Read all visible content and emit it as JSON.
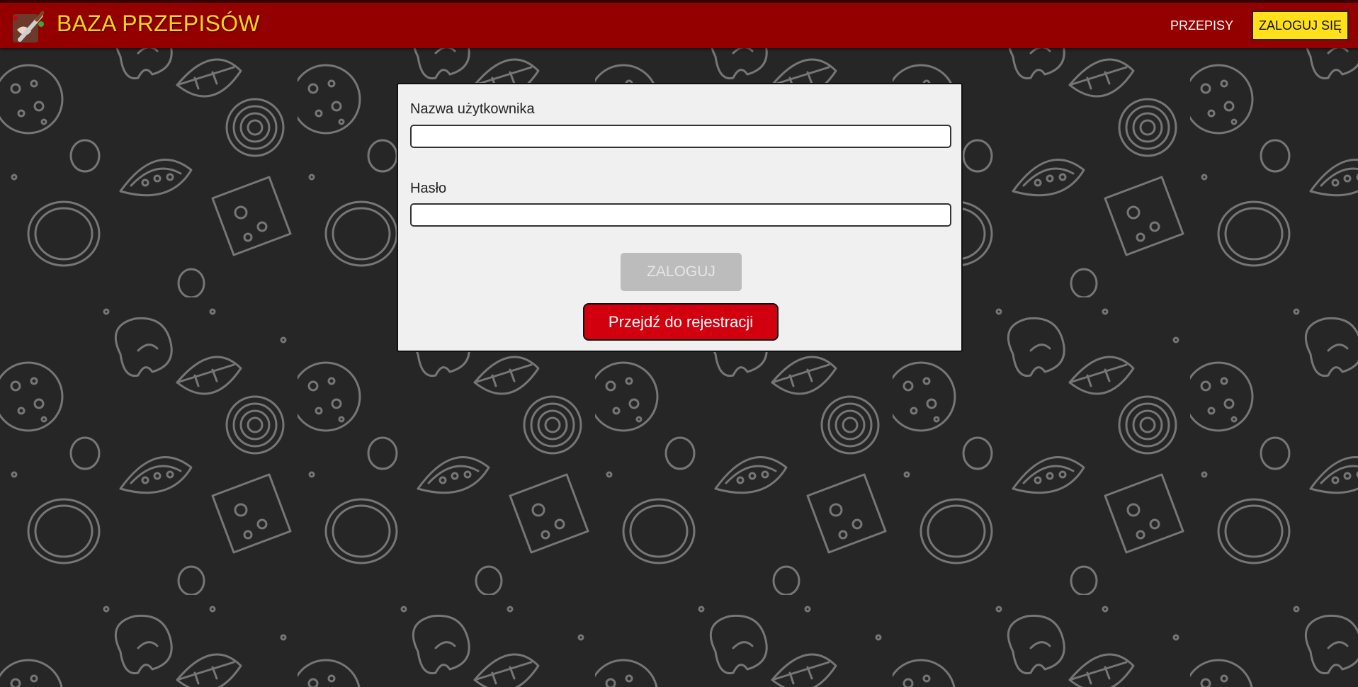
{
  "header": {
    "brand": "BAZA PRZEPISÓW",
    "nav_recipes": "PRZEPISY",
    "nav_login": "ZALOGUJ SIĘ"
  },
  "form": {
    "username_label": "Nazwa użytkownika",
    "username_value": "",
    "password_label": "Hasło",
    "password_value": "",
    "login_button": "ZALOGUJ",
    "register_button": "Przejdź do rejestracji"
  },
  "colors": {
    "header_bg": "#940000",
    "brand_text": "#ffd21a",
    "login_nav_bg": "#ffe01a",
    "panel_bg": "#f0f0f0",
    "login_button_disabled": "#bcbcbc",
    "register_button_bg": "#d2000f",
    "background": "#262626",
    "pattern_stroke": "#8a8a8a"
  },
  "icons": {
    "logo": "chef-knife-dough-icon",
    "background_pattern": "pizza-ingredients-pattern"
  }
}
